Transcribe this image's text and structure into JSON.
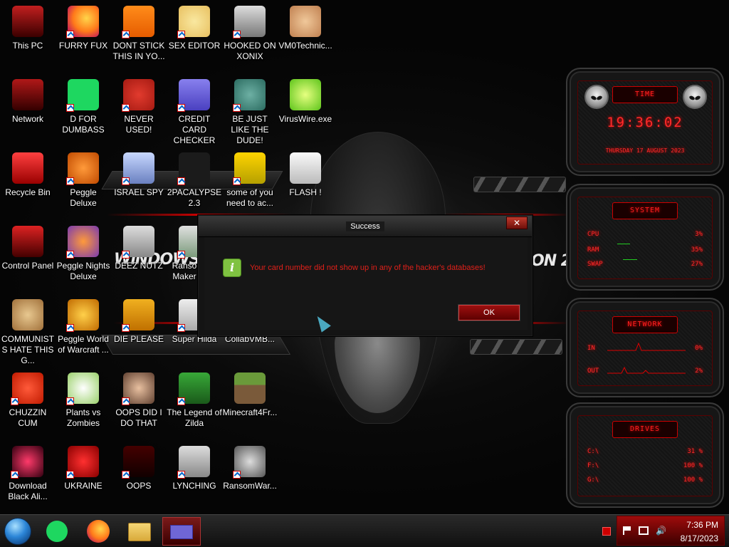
{
  "desktop": {
    "icons": [
      {
        "label": "This PC",
        "icon": "computer-icon"
      },
      {
        "label": "FURRY FUX",
        "icon": "firefox-icon"
      },
      {
        "label": "DONT STICK THIS IN YO...",
        "icon": "vlc-icon"
      },
      {
        "label": "SEX EDITOR",
        "icon": "cartoon-face-icon"
      },
      {
        "label": "HOOKED ON XONIX",
        "icon": "xonix-icon"
      },
      {
        "label": "VM0Technic...",
        "icon": "doctor-icon"
      },
      {
        "label": "Network",
        "icon": "network-icon"
      },
      {
        "label": "D FOR DUMBASS",
        "icon": "spotify-icon"
      },
      {
        "label": "NEVER USED!",
        "icon": "dev-cpp-icon"
      },
      {
        "label": "CREDIT CARD CHECKER",
        "icon": "credit-card-icon"
      },
      {
        "label": "BE JUST LIKE THE DUDE!",
        "icon": "elf-icon"
      },
      {
        "label": "VirusWire.exe",
        "icon": "lime-icon"
      },
      {
        "label": "Recycle Bin",
        "icon": "recycle-bin-icon"
      },
      {
        "label": "Peggle Deluxe",
        "icon": "peggle-icon"
      },
      {
        "label": "ISRAEL SPY",
        "icon": "spy-icon"
      },
      {
        "label": "2PACALYPSE 2.3",
        "icon": "terminal-icon"
      },
      {
        "label": "some of you need to ac...",
        "icon": "dog-icon"
      },
      {
        "label": "FLASH !",
        "icon": "flash-icon"
      },
      {
        "label": "Control Panel",
        "icon": "control-panel-icon"
      },
      {
        "label": "Peggle Nights Deluxe",
        "icon": "peggle-nights-icon"
      },
      {
        "label": "DEEZ NUTZ",
        "icon": "copy-icon"
      },
      {
        "label": "Ransomw... Maker Bu...",
        "icon": "ransomware-icon"
      },
      {
        "label": "COMMUNISTS HATE THIS G...",
        "icon": "money-bag-icon"
      },
      {
        "label": "Peggle World of Warcraft ...",
        "icon": "peggle-wow-icon"
      },
      {
        "label": "DIE PLEASE",
        "icon": "de-icon"
      },
      {
        "label": "Super Hilda",
        "icon": "pixel-icon"
      },
      {
        "label": "CollabVMB...",
        "icon": "collab-icon"
      },
      {
        "label": "CHUZZIN CUM",
        "icon": "chuzzle-icon"
      },
      {
        "label": "Plants vs Zombies",
        "icon": "pvz-icon"
      },
      {
        "label": "OOPS DID I DO THAT",
        "icon": "portrait-icon"
      },
      {
        "label": "The Legend of Zilda",
        "icon": "zelda-icon"
      },
      {
        "label": "Minecraft4Fr...",
        "icon": "minecraft-icon"
      },
      {
        "label": "Download Black Ali...",
        "icon": "black-alien-icon"
      },
      {
        "label": "UKRAINE",
        "icon": "radiation-icon"
      },
      {
        "label": "OOPS",
        "icon": "oops-icon"
      },
      {
        "label": "LYNCHING",
        "icon": "rope-icon"
      },
      {
        "label": "RansomWar...",
        "icon": "skull-icon"
      }
    ]
  },
  "wallpaper": {
    "text_left": "WiNDOWS 8.1",
    "text_right": "ON 20"
  },
  "widgets": {
    "time": {
      "title": "TIME",
      "clock": "19:36:02",
      "date": "THURSDAY 17 AUGUST 2023"
    },
    "system": {
      "title": "SYSTEM",
      "rows": [
        {
          "label": "CPU",
          "value": "3%"
        },
        {
          "label": "RAM",
          "value": "35%"
        },
        {
          "label": "SWAP",
          "value": "27%"
        }
      ]
    },
    "network": {
      "title": "NETWORK",
      "rows": [
        {
          "label": "IN",
          "value": "0%"
        },
        {
          "label": "OUT",
          "value": "2%"
        }
      ]
    },
    "drives": {
      "title": "DRIVES",
      "rows": [
        {
          "label": "C:\\",
          "value": "31 %"
        },
        {
          "label": "F:\\",
          "value": "100 %"
        },
        {
          "label": "G:\\",
          "value": "100 %"
        }
      ]
    }
  },
  "dialog": {
    "title": "Success",
    "close_label": "✕",
    "message": "Your card number did not show up in any of the hacker's databases!",
    "ok_label": "OK"
  },
  "taskbar": {
    "pinned": [
      "start-orb",
      "spotify-icon",
      "firefox-icon",
      "file-explorer-icon",
      "credit-card-icon"
    ],
    "clock_time": "7:36 PM",
    "clock_date": "8/17/2023"
  },
  "colors": {
    "accent": "#cc0000",
    "dialog_text": "#e0201a",
    "ok_button": "#8a0b0b"
  }
}
